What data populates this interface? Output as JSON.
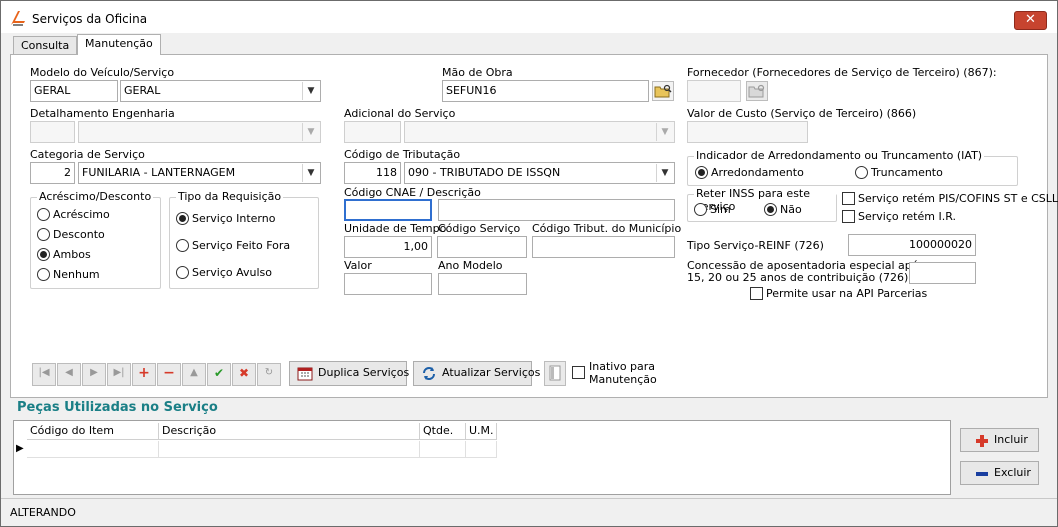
{
  "window": {
    "title": "Serviços da Oficina",
    "close_glyph": "✕"
  },
  "tabs": [
    {
      "label": "Consulta",
      "active": false
    },
    {
      "label": "Manutenção",
      "active": true
    }
  ],
  "form": {
    "modelo": {
      "label": "Modelo do Veículo/Serviço",
      "code": "GERAL",
      "select": "GERAL"
    },
    "detalhamento": {
      "label": "Detalhamento Engenharia",
      "code": "",
      "select": ""
    },
    "categoria": {
      "label": "Categoria de Serviço",
      "code": "2",
      "select": "FUNILARIA - LANTERNAGEM"
    },
    "mao_obra": {
      "label": "Mão de Obra",
      "value": "SEFUN16"
    },
    "adicional": {
      "label": "Adicional do Serviço",
      "code": "",
      "select": ""
    },
    "tributacao": {
      "label": "Código de Tributação",
      "code": "118",
      "select": "090 - TRIBUTADO DE ISSQN"
    },
    "cnae": {
      "label": "Código CNAE / Descrição",
      "code": "",
      "desc": ""
    },
    "unidade_tempo": {
      "label": "Unidade de Tempo",
      "value": "1,00"
    },
    "codigo_servico": {
      "label": "Código Serviço",
      "value": ""
    },
    "codigo_tribut_municipio": {
      "label": "Código Tribut. do Município",
      "value": ""
    },
    "valor": {
      "label": "Valor",
      "value": ""
    },
    "ano_modelo": {
      "label": "Ano Modelo",
      "value": ""
    },
    "fornecedor": {
      "label": "Fornecedor (Fornecedores de Serviço de Terceiro) (867):",
      "value": ""
    },
    "valor_custo": {
      "label": "Valor de Custo (Serviço de Terceiro) (866)",
      "value": ""
    },
    "iat": {
      "label": "Indicador de Arredondamento ou Truncamento (IAT)",
      "options": [
        "Arredondamento",
        "Truncamento"
      ],
      "selected": "Arredondamento"
    },
    "reter_inss": {
      "label": "Reter INSS para este serviço",
      "options": [
        "Sim",
        "Não"
      ],
      "selected": "Não"
    },
    "pis_cofins": {
      "label": "Serviço retém PIS/COFINS ST e CSLL",
      "checked": false
    },
    "retem_ir": {
      "label": "Serviço retém I.R.",
      "checked": false
    },
    "tipo_reinf": {
      "label": "Tipo Serviço-REINF (726)",
      "value": "100000020"
    },
    "aposentadoria": {
      "label_line1": "Concessão de aposentadoria especial após",
      "label_line2": "15, 20 ou 25 anos de contribuição (726):",
      "value": ""
    },
    "api_parcerias": {
      "label": "Permite usar na API Parcerias",
      "checked": false
    },
    "acrescimo": {
      "label": "Acréscimo/Desconto",
      "options": [
        "Acréscimo",
        "Desconto",
        "Ambos",
        "Nenhum"
      ],
      "selected": "Ambos"
    },
    "tipo_requisicao": {
      "label": "Tipo da Requisição",
      "options": [
        "Serviço Interno",
        "Serviço Feito Fora",
        "Serviço Avulso"
      ],
      "selected": "Serviço Interno"
    }
  },
  "toolbar": {
    "nav_glyphs": [
      "|◀",
      "◀",
      "▶",
      "▶|",
      "+",
      "−",
      "▲",
      "✔",
      "✖",
      "↻"
    ],
    "duplica": "Duplica Serviços",
    "atualizar": "Atualizar Serviços",
    "inativo_line1": "Inativo para",
    "inativo_line2": "Manutenção"
  },
  "pecas": {
    "title": "Peças Utilizadas no Serviço",
    "columns": [
      "Código do Item",
      "Descrição",
      "Qtde.",
      "U.M."
    ],
    "incluir": "Incluir",
    "excluir": "Excluir"
  },
  "status": {
    "text": "ALTERANDO"
  },
  "colors": {
    "accent_teal": "#1a7f86",
    "add_red": "#d63a2a",
    "remove_blue": "#1a3fa0",
    "close_red": "#c7442f"
  }
}
